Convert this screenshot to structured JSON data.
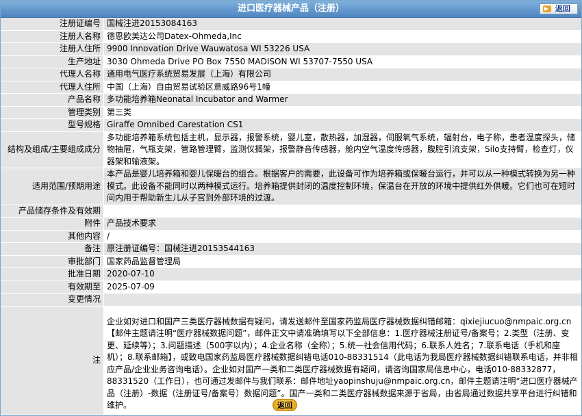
{
  "header": {
    "title": "进口医疗器械产品（注册）",
    "back_label": "返回"
  },
  "rows": [
    {
      "label": "注册证编号",
      "value": "国械注进20153084163"
    },
    {
      "label": "注册人名称",
      "value": "德恩欧美达公司Datex-Ohmeda,Inc"
    },
    {
      "label": "注册人住所",
      "value": "9900 Innovation Drive Wauwatosa WI 53226 USA"
    },
    {
      "label": "生产地址",
      "value": "3030 Ohmeda Drive PO Box 7550 MADISON WI 53707-7550 USA"
    },
    {
      "label": "代理人名称",
      "value": "通用电气医疗系统贸易发展（上海）有限公司"
    },
    {
      "label": "代理人住所",
      "value": "中国（上海）自由贸易试验区意威路96号1幢"
    },
    {
      "label": "产品名称",
      "value": "多功能培养箱Neonatal Incubator and Warmer"
    },
    {
      "label": "管理类别",
      "value": "第三类"
    },
    {
      "label": "型号规格",
      "value": "Giraffe Omnibed Carestation CS1"
    },
    {
      "label": "结构及组成/主要组成成分",
      "value": "多功能培养箱系统包括主机，显示器，报警系统，婴儿室，散热器，加湿器，伺服氧气系统，辐射台，电子称，患者温度探头，储物抽屉，气瓶支架，管路管理臂，监测仪搁架，报警静音传感器，舱内空气温度传感器，腹腔引流支架，Silo支持臂，检查灯，仪器架和输液架。"
    },
    {
      "label": "适用范围/预期用途",
      "value": "本产品是婴儿培养箱和婴儿保暖台的组合。根据客户的需要，此设备可作为培养箱或保暖台运行，并可以从一种模式转换为另一种模式。此设备不能同时以两种模式运行。培养箱提供封闭的温度控制环境，保温台在开放的环境中提供红外供暖。它们也可在短时间内用于帮助新生儿从子宫到外部环境的过渡。"
    },
    {
      "label": "产品储存条件及有效期",
      "value": ""
    },
    {
      "label": "附件",
      "value": "产品技术要求"
    },
    {
      "label": "其他内容",
      "value": "/"
    },
    {
      "label": "备注",
      "value": "原注册证编号：国械注进20153544163"
    },
    {
      "label": "审批部门",
      "value": "国家药品监督管理局"
    },
    {
      "label": "批准日期",
      "value": "2020-07-10"
    },
    {
      "label": "有效期至",
      "value": "2025-07-09"
    },
    {
      "label": "变更情况",
      "value": ""
    },
    {
      "label": "注",
      "value": "企业如对进口和国产三类医疗器械数据有疑问，请发送邮件至国家药监局医疗器械数据纠错邮箱：qixiejiucuo@nmpaic.org.cn【邮件主题请注明“医疗器械数据问题”，邮件正文中请准确填写以下全部信息：1.医疗器械注册证号/备案号；2.类型（注册、变更、延续等）；3.问题描述（500字以内）；4.企业名称（全称）；5.统一社会信用代码；6.联系人姓名；7.联系电话（手机和座机）；8.联系邮箱】，或致电国家药监局医疗器械数据纠错电话010-88331514（此电话为我局医疗器械数据纠错联系电话，并非相应产品/企业业务咨询电话）。企业如对国产一类和二类医疗器械数据有疑问，请咨询国家局信息中心，电话010-88332877，88331520（工作日），也可通过发邮件与我们联系：邮件地址yaopinshuju@nmpaic.org.cn，邮件主题请注明“进口医疗器械产品（注册）-数据（注册证号/备案号）数据问题”。国产一类和二类医疗器械数据来源于省局，由省局通过数据共享平台进行纠错和维护。"
    }
  ],
  "footer": {
    "back_label": "返回"
  }
}
